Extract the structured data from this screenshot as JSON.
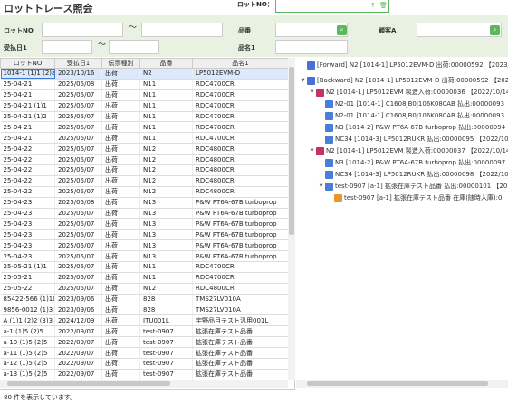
{
  "app": {
    "title": "ロットトレース照会"
  },
  "header": {
    "lotno_label": "ロットNO："
  },
  "filters": {
    "lotno_label": "ロットNO",
    "tilde": "〜",
    "hinban_label": "品番",
    "customer_label": "顧客A",
    "date_label": "受払日1",
    "hinmei_label": "品名1",
    "search_icon": "search-icon"
  },
  "grid": {
    "columns": [
      "ロットNO",
      "受払日1",
      "伝票種別",
      "品番",
      "品名1"
    ],
    "rows": [
      [
        "1014-1 (1)1 (2)a",
        "2023/10/16",
        "出荷",
        "N2",
        "LP5012EVM-D"
      ],
      [
        "25-04-21",
        "2025/05/08",
        "出荷",
        "N11",
        "RDC4700CR"
      ],
      [
        "25-04-21",
        "2025/05/07",
        "出荷",
        "N11",
        "RDC4700CR"
      ],
      [
        "25-04-21 (1)1",
        "2025/05/07",
        "出荷",
        "N11",
        "RDC4700CR"
      ],
      [
        "25-04-21 (1)2",
        "2025/05/07",
        "出荷",
        "N11",
        "RDC4700CR"
      ],
      [
        "25-04-21",
        "2025/05/07",
        "出荷",
        "N11",
        "RDC4700CR"
      ],
      [
        "25-04-21",
        "2025/05/07",
        "出荷",
        "N11",
        "RDC4700CR"
      ],
      [
        "25-04-22",
        "2025/05/07",
        "出荷",
        "N12",
        "RDC4800CR"
      ],
      [
        "25-04-22",
        "2025/05/07",
        "出荷",
        "N12",
        "RDC4800CR"
      ],
      [
        "25-04-22",
        "2025/05/07",
        "出荷",
        "N12",
        "RDC4800CR"
      ],
      [
        "25-04-22",
        "2025/05/07",
        "出荷",
        "N12",
        "RDC4800CR"
      ],
      [
        "25-04-22",
        "2025/05/07",
        "出荷",
        "N12",
        "RDC4800CR"
      ],
      [
        "25-04-23",
        "2025/05/08",
        "出荷",
        "N13",
        "P&W PT6A-67B turboprop"
      ],
      [
        "25-04-23",
        "2025/05/07",
        "出荷",
        "N13",
        "P&W PT6A-67B turboprop"
      ],
      [
        "25-04-23",
        "2025/05/07",
        "出荷",
        "N13",
        "P&W PT6A-67B turboprop"
      ],
      [
        "25-04-23",
        "2025/05/07",
        "出荷",
        "N13",
        "P&W PT6A-67B turboprop"
      ],
      [
        "25-04-23",
        "2025/05/07",
        "出荷",
        "N13",
        "P&W PT6A-67B turboprop"
      ],
      [
        "25-04-23",
        "2025/05/07",
        "出荷",
        "N13",
        "P&W PT6A-67B turboprop"
      ],
      [
        "25-05-21 (1)1",
        "2025/05/07",
        "出荷",
        "N11",
        "RDC4700CR"
      ],
      [
        "25-05-21",
        "2025/05/07",
        "出荷",
        "N11",
        "RDC4700CR"
      ],
      [
        "25-05-22",
        "2025/05/07",
        "出荷",
        "N12",
        "RDC4800CR"
      ],
      [
        "85422-566 (1)10 (",
        "2023/09/06",
        "出荷",
        "828",
        "TMS27LV010A"
      ],
      [
        "9856-0012 (1)3 (",
        "2023/09/06",
        "出荷",
        "828",
        "TMS27LV010A"
      ],
      [
        "A (1)1 (2)2 (3)3 (5",
        "2024/12/09",
        "出荷",
        "ITU001L",
        "宇野品目テスト汎用001L"
      ],
      [
        "a-1 (1)5 (2)5",
        "2022/09/07",
        "出荷",
        "test-0907",
        "拡張在庫テスト品番"
      ],
      [
        "a-10 (1)5 (2)5",
        "2022/09/07",
        "出荷",
        "test-0907",
        "拡張在庫テスト品番"
      ],
      [
        "a-11 (1)5 (2)5",
        "2022/09/07",
        "出荷",
        "test-0907",
        "拡張在庫テスト品番"
      ],
      [
        "a-12 (1)5 (2)5",
        "2022/09/07",
        "出荷",
        "test-0907",
        "拡張在庫テスト品番"
      ],
      [
        "a-13 (1)5 (2)5",
        "2022/09/07",
        "出荷",
        "test-0907",
        "拡張在庫テスト品番"
      ]
    ]
  },
  "status": {
    "text": "80 件を表示しています。"
  },
  "tree": {
    "nodes": [
      {
        "text": "[Forward] N2 [1014-1] LP5012EVM-D 出荷:00000592 【2023/10/",
        "color": "#4a6fd8"
      },
      {
        "text": "[Backward] N2 [1014-1] LP5012EVM-D 出荷:00000592 【2023/1",
        "color": "#4a6fd8"
      },
      {
        "text": "N2 [1014-1] LP5012EVM 製造入荷:00000036 【2022/10/14",
        "color": "#c2336a"
      },
      {
        "text": "N2-01 [1014-1] C1608JB0J106K080AB 払出:00000093",
        "color": "#4a7fd8"
      },
      {
        "text": "N2-01 [1014-1] C1608JB0J106K080AB 払出:00000093",
        "color": "#4a7fd8"
      },
      {
        "text": "N3 [1014-2] P&W PT6A-67B turboprop 払出:00000094",
        "color": "#4a7fd8"
      },
      {
        "text": "NC34 [1014-3] LP5012RUKR 払出:00000095 【2022/10/14",
        "color": "#4a7fd8"
      },
      {
        "text": "N2 [1014-1] LP5012EVM 製造入荷:00000037 【2022/10/14",
        "color": "#c2336a"
      },
      {
        "text": "N3 [1014-2] P&W PT6A-67B turboprop 払出:00000097",
        "color": "#4a7fd8"
      },
      {
        "text": "NC34 [1014-3] LP5012RUKR 払出:00000098 【2022/10/14",
        "color": "#4a7fd8"
      },
      {
        "text": "test-0907 [a-1] 拡張在庫テスト品番 払出:00000101 【20",
        "color": "#4a7fd8"
      },
      {
        "text": "test-0907 [a-1] 拡張在庫テスト品番 在庫(随時入庫):0",
        "color": "#e8962e"
      }
    ]
  }
}
